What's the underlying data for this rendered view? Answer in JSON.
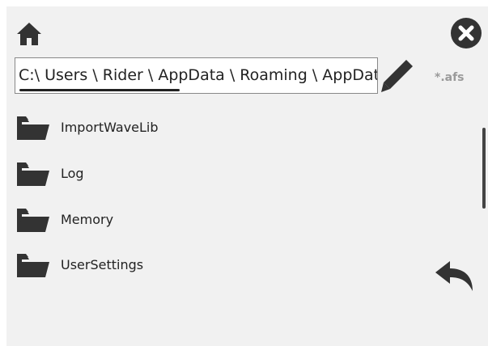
{
  "icons": {
    "home": "home-icon",
    "close": "close-icon",
    "edit": "pencil-icon",
    "folder": "folder-icon",
    "back": "back-arrow-icon"
  },
  "colors": {
    "panel_background": "#f1f1f1",
    "icon_dark": "#333333",
    "filter_text": "#9a9a9a"
  },
  "path_bar": {
    "value": "C:\\ Users \\ Rider  \\ AppData \\ Roaming \\ AppData"
  },
  "filter": {
    "label": "*.afs"
  },
  "folders": [
    {
      "label": "ImportWaveLib"
    },
    {
      "label": "Log"
    },
    {
      "label": "Memory"
    },
    {
      "label": "UserSettings"
    }
  ]
}
